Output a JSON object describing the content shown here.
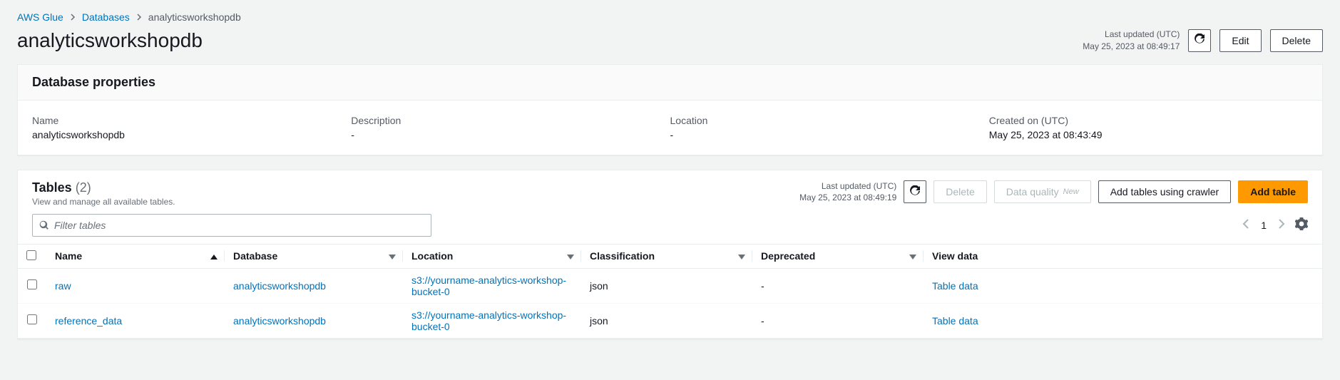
{
  "breadcrumbs": {
    "root": "AWS Glue",
    "mid": "Databases",
    "current": "analyticsworkshopdb"
  },
  "header": {
    "title": "analyticsworkshopdb",
    "last_updated_label": "Last updated (UTC)",
    "last_updated_value": "May 25, 2023 at 08:49:17",
    "edit_label": "Edit",
    "delete_label": "Delete"
  },
  "properties": {
    "title": "Database properties",
    "name_label": "Name",
    "name_value": "analyticsworkshopdb",
    "description_label": "Description",
    "description_value": "-",
    "location_label": "Location",
    "location_value": "-",
    "created_label": "Created on (UTC)",
    "created_value": "May 25, 2023 at 08:43:49"
  },
  "tables": {
    "title": "Tables",
    "count": "(2)",
    "subtitle": "View and manage all available tables.",
    "last_updated_label": "Last updated (UTC)",
    "last_updated_value": "May 25, 2023 at 08:49:19",
    "delete_label": "Delete",
    "dq_label": "Data quality",
    "dq_badge": "New",
    "add_crawler_label": "Add tables using crawler",
    "add_table_label": "Add table",
    "filter_placeholder": "Filter tables",
    "page_number": "1",
    "columns": {
      "name": "Name",
      "database": "Database",
      "location": "Location",
      "classification": "Classification",
      "deprecated": "Deprecated",
      "viewdata": "View data"
    },
    "rows": [
      {
        "name": "raw",
        "database": "analyticsworkshopdb",
        "location": "s3://yourname-analytics-workshop-bucket-0",
        "classification": "json",
        "deprecated": "-",
        "viewdata": "Table data"
      },
      {
        "name": "reference_data",
        "database": "analyticsworkshopdb",
        "location": "s3://yourname-analytics-workshop-bucket-0",
        "classification": "json",
        "deprecated": "-",
        "viewdata": "Table data"
      }
    ]
  }
}
